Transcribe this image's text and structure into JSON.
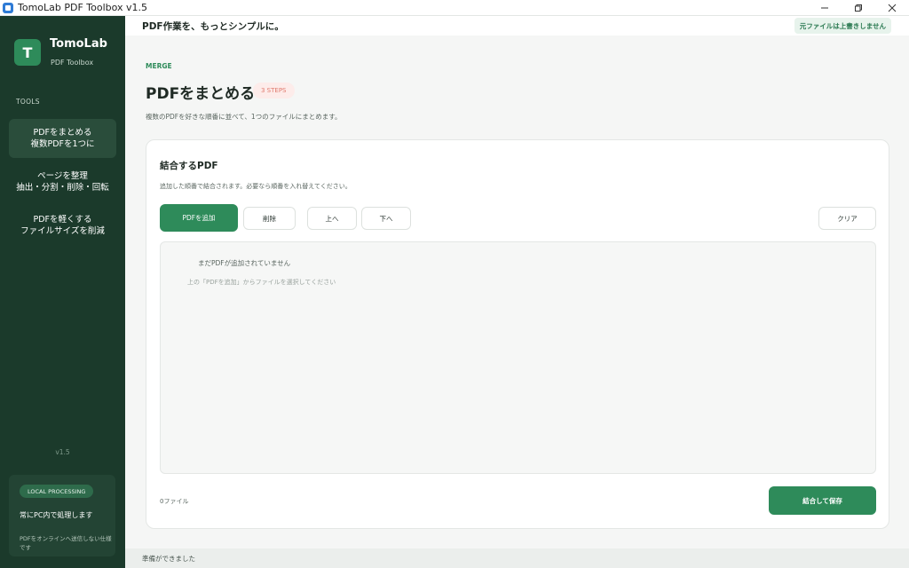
{
  "window": {
    "title": "TomoLab PDF Toolbox v1.5",
    "controls": [
      "minimize-icon",
      "restore-icon",
      "close-icon"
    ]
  },
  "sidebar": {
    "logo_letter": "T",
    "brand_name": "TomoLab",
    "brand_sub": "PDF Toolbox",
    "section_label": "TOOLS",
    "items": [
      {
        "line1": "PDFをまとめる",
        "line2": "複数PDFを1つに",
        "active": true
      },
      {
        "line1": "ページを整理",
        "line2": "抽出・分割・削除・回転",
        "active": false
      },
      {
        "line1": "PDFを軽くする",
        "line2": "ファイルサイズを削減",
        "active": false
      }
    ],
    "version": "v1.5",
    "local_card": {
      "badge": "LOCAL PROCESSING",
      "title": "常にPC内で処理します",
      "note": "PDFをオンラインへ送信しない仕様です"
    }
  },
  "header": {
    "tagline": "PDF作業を、もっとシンプルに。",
    "notice": "元ファイルは上書きしません"
  },
  "main": {
    "kicker": "MERGE",
    "title": "PDFをまとめる",
    "steps_badge": "3 STEPS",
    "description": "複数のPDFを好きな順番に並べて、1つのファイルにまとめます。",
    "card": {
      "title": "結合するPDF",
      "description": "追加した順番で結合されます。必要なら順番を入れ替えてください。",
      "buttons": {
        "add": "PDFを追加",
        "delete": "削除",
        "up": "上へ",
        "down": "下へ",
        "clear": "クリア",
        "save": "結合して保存"
      },
      "empty_title": "まだPDFが追加されていません",
      "empty_hint": "上の「PDFを追加」からファイルを選択してください",
      "file_count": "0ファイル"
    }
  },
  "status": {
    "text": "準備ができました"
  },
  "colors": {
    "sidebar_bg": "#1b3a2b",
    "accent": "#2e8b5a",
    "steps_badge": "#e07a6e"
  }
}
